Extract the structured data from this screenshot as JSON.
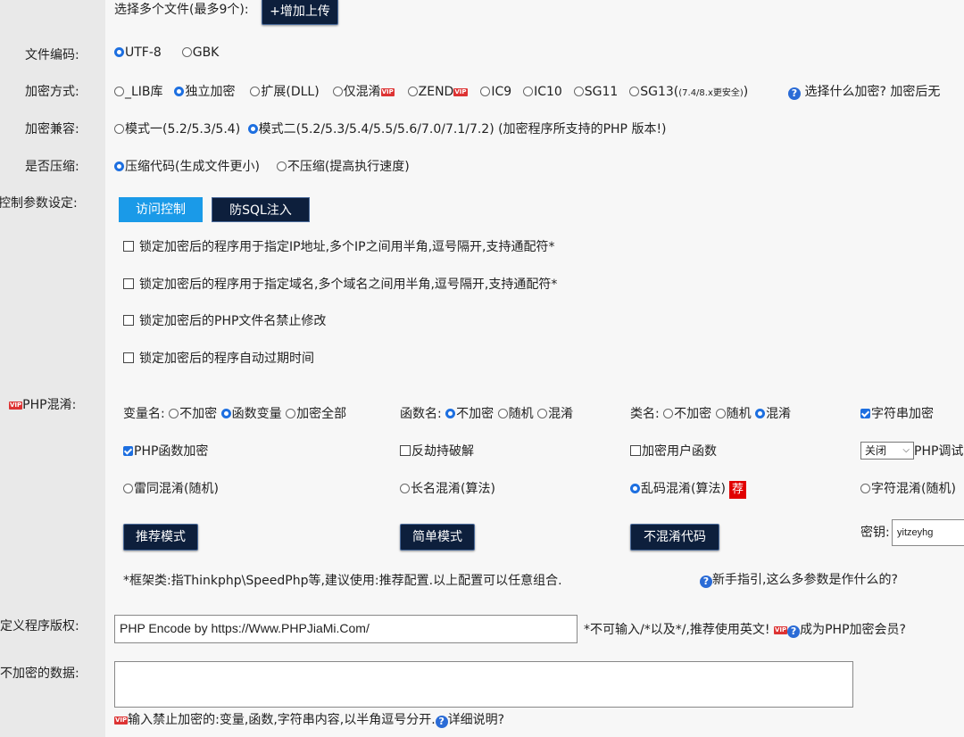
{
  "upload": {
    "label": "选择多个文件(最多9个):",
    "button": "+增加上传"
  },
  "encoding": {
    "label": "文件编码:",
    "options": [
      "UTF-8",
      "GBK"
    ],
    "selected": "UTF-8"
  },
  "encrypt_method": {
    "label": "加密方式:",
    "options": [
      "_LIB库",
      "独立加密",
      "扩展(DLL)",
      "仅混淆",
      "ZEND",
      "IC9",
      "IC10",
      "SG11",
      "SG13"
    ],
    "sg13_note": "(7.4/8.x更安全)",
    "selected": "独立加密",
    "help": "选择什么加密? 加密后无"
  },
  "compat": {
    "label": "加密兼容:",
    "mode1": "模式一(5.2/5.3/5.4)",
    "mode2": "模式二(5.2/5.3/5.4/5.5/5.6/7.0/7.1/7.2)",
    "note": "(加密程序所支持的PHP 版本!)",
    "selected": "mode2"
  },
  "compress": {
    "label": "是否压缩:",
    "on": "压缩代码(生成文件更小)",
    "off": "不压缩(提高执行速度)",
    "selected": "on"
  },
  "control": {
    "label": "控制参数设定:",
    "tabs": [
      "访问控制",
      "防SQL注入"
    ],
    "checks": [
      "锁定加密后的程序用于指定IP地址,多个IP之间用半角,逗号隔开,支持通配符*",
      "锁定加密后的程序用于指定域名,多个域名之间用半角,逗号隔开,支持通配符*",
      "锁定加密后的PHP文件名禁止修改",
      "锁定加密后的程序自动过期时间"
    ]
  },
  "obfuscate": {
    "label": "PHP混淆:",
    "var": {
      "title": "变量名:",
      "options": [
        "不加密",
        "函数变量",
        "加密全部"
      ],
      "selected": "函数变量"
    },
    "func": {
      "title": "函数名:",
      "options": [
        "不加密",
        "随机",
        "混淆"
      ],
      "selected": "不加密"
    },
    "cls": {
      "title": "类名:",
      "options": [
        "不加密",
        "随机",
        "混淆"
      ],
      "selected": "混淆"
    },
    "string_encrypt": "字符串加密",
    "php_func_encrypt": "PHP函数加密",
    "anti_hijack": "反劫持破解",
    "user_func": "加密用户函数",
    "debug_select": "关闭",
    "debug_label": "PHP调试",
    "mix1": "雷同混淆(随机)",
    "mix2": "长名混淆(算法)",
    "mix3": "乱码混淆(算法)",
    "mix3_badge": "荐",
    "mix4": "字符混淆(随机)",
    "buttons": [
      "推荐模式",
      "简单模式",
      "不混淆代码"
    ],
    "key_label": "密钥:",
    "key_value": "yitzeyhg",
    "framework_note": "*框架类:指Thinkphp\\SpeedPhp等,建议使用:推荐配置.以上配置可以任意组合.",
    "guide": "新手指引,这么多参数是作什么的?"
  },
  "copyright": {
    "label": "定义程序版权:",
    "value": "PHP Encode by  https://Www.PHPJiaMi.Com/",
    "note": "*不可输入/*以及*/,推荐使用英文!",
    "member": "成为PHP加密会员?"
  },
  "noencrypt": {
    "label": "不加密的数据:",
    "hint": "输入禁止加密的:变量,函数,字符串内容,以半角逗号分开.",
    "detail": "详细说明?"
  },
  "colors": {
    "accent": "#1d6fe0",
    "tab_active": "#1a9ae8",
    "dark_button": "#0d1f3c",
    "vip_red": "#d33333"
  },
  "icons": {
    "help": "question-circle-icon",
    "vip": "vip-badge-icon"
  }
}
